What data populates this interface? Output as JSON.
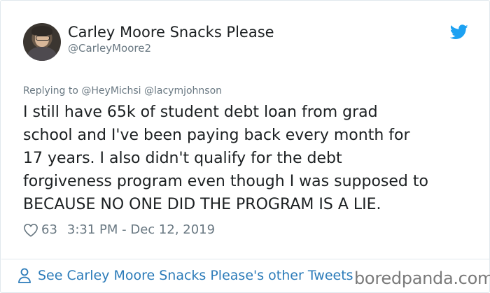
{
  "author": {
    "display_name": "Carley Moore Snacks Please",
    "handle": "@CarleyMoore2"
  },
  "reply": {
    "prefix": "Replying to ",
    "mentions": "@HeyMichsi @lacymjohnson"
  },
  "tweet": {
    "lines": [
      "I still have 65k of student debt loan from grad",
      "school and I've been paying back every month for",
      "17 years.  I also didn't qualify for the debt",
      "forgiveness program even though I was supposed to",
      "BECAUSE NO ONE DID THE PROGRAM IS A LIE."
    ]
  },
  "meta": {
    "likes": "63",
    "timestamp": "3:31 PM - Dec 12, 2019"
  },
  "footer": {
    "link_text": "See Carley Moore Snacks Please's other Tweets"
  },
  "watermark": "boredpanda.com",
  "icons": {
    "brand": "twitter-bird-icon",
    "like": "heart-icon",
    "profile": "person-icon"
  },
  "colors": {
    "brand_blue": "#1da1f2",
    "link_blue": "#2b7bb9",
    "muted": "#697882",
    "text": "#1c2022"
  }
}
